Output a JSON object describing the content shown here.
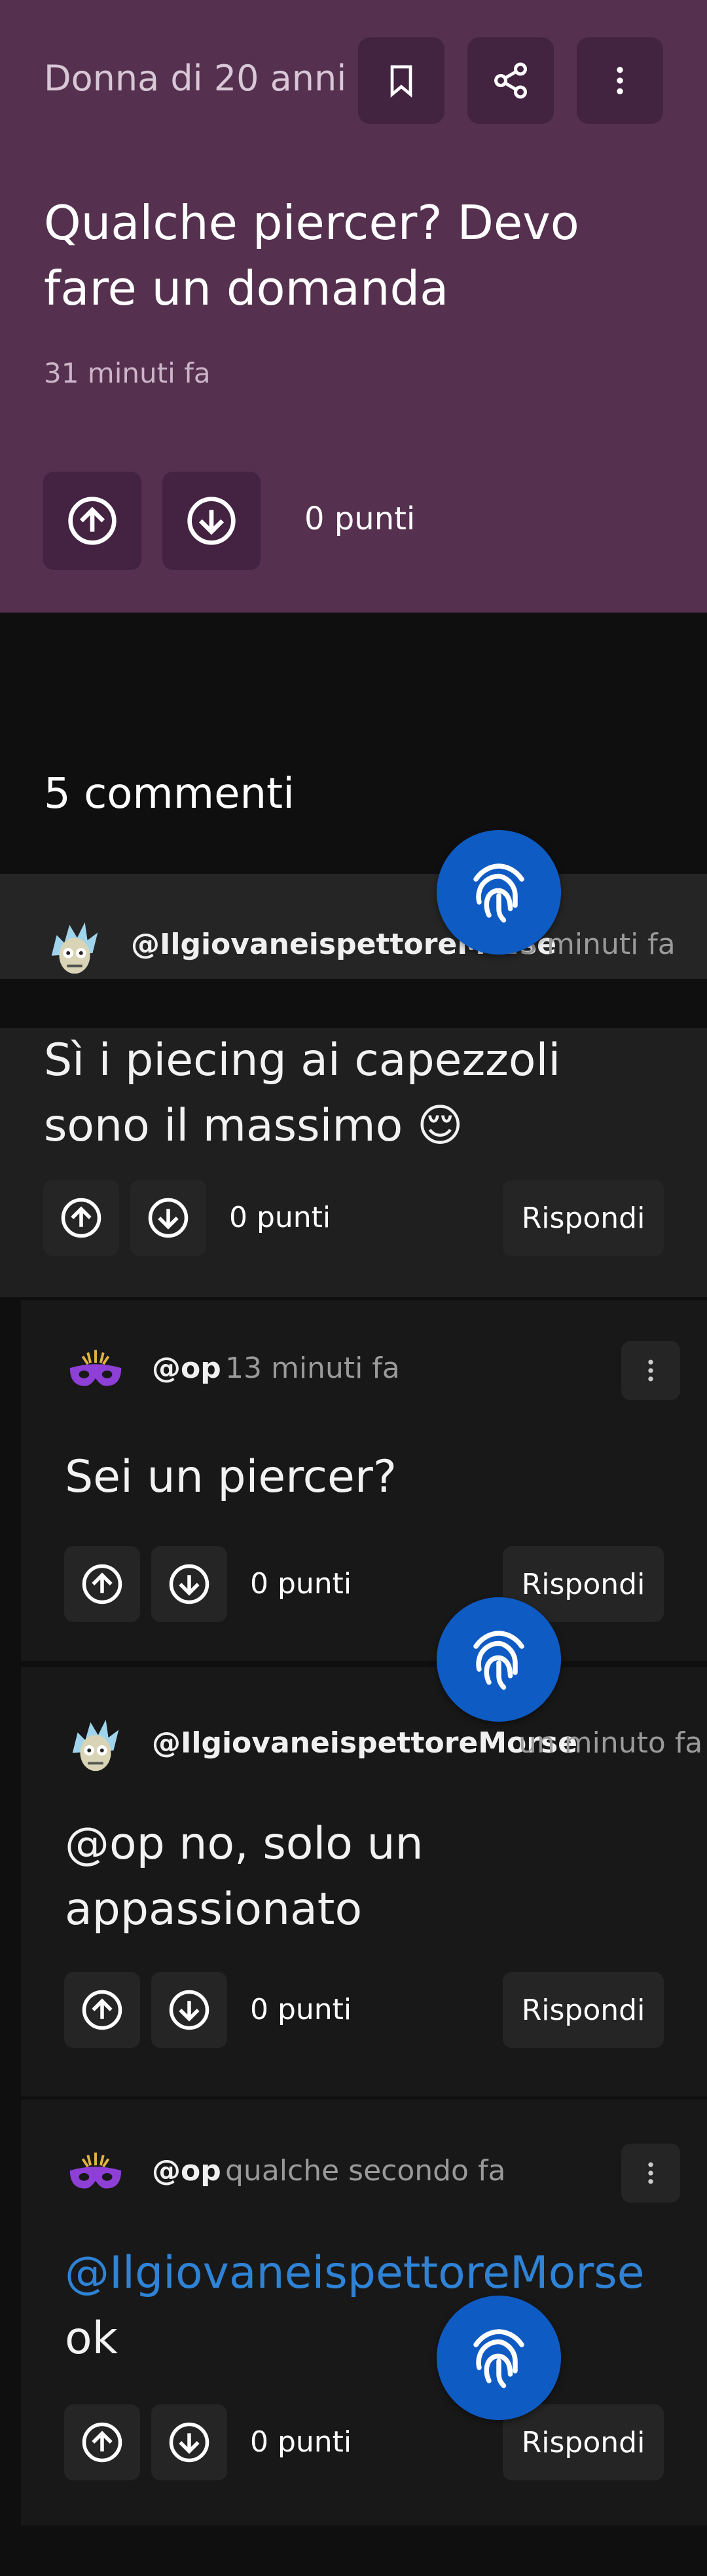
{
  "post": {
    "author": "Donna di 20 anni",
    "title": "Qualche piercer? Devo fare un domanda",
    "time": "31 minuti fa",
    "points": "0 punti"
  },
  "comments_header": "5 commenti",
  "comments": [
    {
      "user": "@IlgiovaneispettoreMorse",
      "time": "13 minuti fa",
      "text": "Sì i piecing ai capezzoli sono il massimo 😌",
      "points": "0 punti",
      "reply": "Rispondi"
    },
    {
      "user": "@op",
      "time": "13 minuti fa",
      "text": "Sei un piercer?",
      "points": "0 punti",
      "reply": "Rispondi"
    },
    {
      "user": "@IlgiovaneispettoreMorse",
      "time": "un minuto fa",
      "text": "@op no, solo un appassionato",
      "points": "0 punti",
      "reply": "Rispondi"
    },
    {
      "user": "@op",
      "time": "qualche secondo fa",
      "mention": "@IlgiovaneispettoreMorse",
      "text": "ok",
      "points": "0 punti",
      "reply": "Rispondi"
    }
  ],
  "colors": {
    "header_bg": "#55304f",
    "page_bg": "#0f0f0f",
    "card_bg": "#1f1f1f",
    "reply_bg": "#181818",
    "fab": "#0f5bc4",
    "link": "#2f83d6"
  },
  "icons": [
    "bookmark-icon",
    "share-icon",
    "more-vertical-icon",
    "upvote-icon",
    "downvote-icon",
    "fingerprint-icon",
    "rick-avatar",
    "mask-avatar"
  ]
}
